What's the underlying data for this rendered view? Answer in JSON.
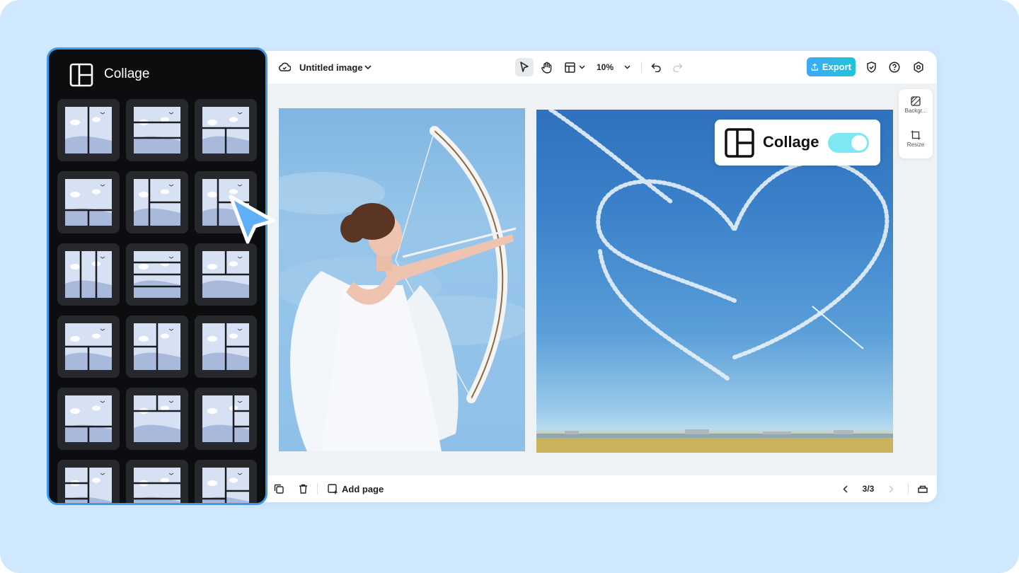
{
  "editor": {
    "doc_title": "Untitled image",
    "zoom": "10%",
    "export_label": "Export",
    "right_panel": {
      "background_label": "Backgr...",
      "resize_label": "Resize"
    },
    "collage_toggle": {
      "label": "Collage",
      "enabled": true
    },
    "bottom": {
      "add_page_label": "Add page",
      "page_indicator": "3/3"
    }
  },
  "side_panel": {
    "title": "Collage",
    "layouts": [
      "two-columns",
      "three-rows",
      "one-top-two-bottom-rows",
      "large-top-two-small-bottom",
      "large-left-two-right",
      "narrow-left-two-right",
      "three-columns",
      "four-rows",
      "two-by-two-top-wide-bottom",
      "top-wide-two-bottom",
      "left-two-right-wide",
      "left-wide-right-two",
      "top-wide-bottom-two",
      "top-split-bottom-wide",
      "left-wide-right-three",
      "mosaic-a",
      "mosaic-b",
      "mosaic-c"
    ]
  },
  "colors": {
    "background": "#cfe8fd",
    "panel_border": "#3d9be9",
    "export_start": "#3ea8f8",
    "export_end": "#1ec6d8",
    "toggle_on": "#7ee8f2"
  }
}
